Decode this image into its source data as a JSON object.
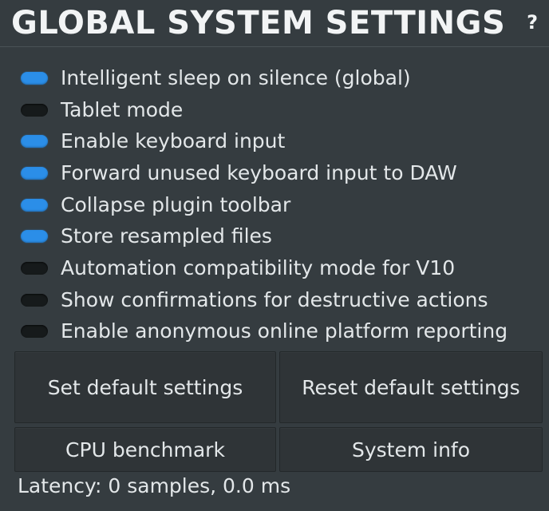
{
  "header": {
    "title": "GLOBAL SYSTEM SETTINGS",
    "help_label": "?"
  },
  "settings": [
    {
      "label": "Intelligent sleep on silence (global)",
      "enabled": true
    },
    {
      "label": "Tablet mode",
      "enabled": false
    },
    {
      "label": "Enable keyboard input",
      "enabled": true
    },
    {
      "label": "Forward unused keyboard input to DAW",
      "enabled": true
    },
    {
      "label": "Collapse plugin toolbar",
      "enabled": true
    },
    {
      "label": "Store resampled files",
      "enabled": true
    },
    {
      "label": "Automation compatibility mode for V10",
      "enabled": false
    },
    {
      "label": "Show confirmations for destructive actions",
      "enabled": false
    },
    {
      "label": "Enable anonymous online platform reporting",
      "enabled": false
    }
  ],
  "buttons": {
    "set_default": "Set default settings",
    "reset_default": "Reset default settings",
    "cpu_benchmark": "CPU benchmark",
    "system_info": "System info"
  },
  "status": {
    "latency": "Latency: 0 samples, 0.0 ms"
  },
  "colors": {
    "background": "#353c40",
    "toggle_on": "#2b8ee8",
    "toggle_off": "#161a1b",
    "text": "#e3e7e9"
  }
}
